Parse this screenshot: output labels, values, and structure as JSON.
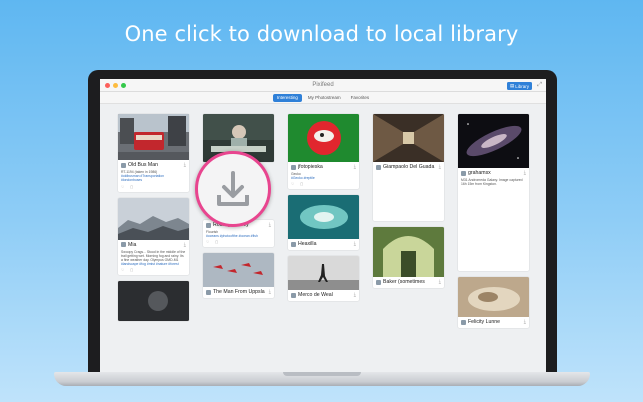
{
  "headline": "One click to download to local library",
  "app": {
    "title": "Pixifeed",
    "library_label": "Library"
  },
  "tabs": [
    {
      "label": "Interesting",
      "active": true
    },
    {
      "label": "My Photostream",
      "active": false
    },
    {
      "label": "Favorites",
      "active": false
    }
  ],
  "colors": {
    "accent": "#2f80d8",
    "badge_ring": "#e8458f"
  },
  "icons": {
    "download": "download-icon",
    "expand": "expand-icon"
  },
  "columns": [
    [
      {
        "user": "Old Bus Man",
        "caption": "RT-1194 (taken in 1986)",
        "tags": "#oldbusman #Transportation #londonbuses",
        "faves": "",
        "comments": ""
      },
      {
        "user": "Mia",
        "caption": "Swoopy Crags... Stood in the middle of the trail getting wet. Morning fog and rainy. Its a fine weather day. Olympus OMD-M1",
        "tags": "#landscape #fog #mist #nature #forest",
        "faves": "",
        "comments": ""
      },
      {
        "user": "",
        "caption": "",
        "tags": "",
        "faves": "",
        "comments": ""
      }
    ],
    [
      {
        "user": "",
        "caption": "",
        "tags": "",
        "faves": "",
        "comments": ""
      },
      {
        "user": "Rodney Harvey",
        "caption": "Flourish",
        "tags": "#oceans #photoofthe #ocean #fish",
        "faves": "",
        "comments": ""
      },
      {
        "user": "The Man From Uppsla",
        "caption": "",
        "tags": "",
        "faves": "",
        "comments": ""
      }
    ],
    [
      {
        "user": "jfotopieska",
        "caption": "Gecko",
        "tags": "#Gecko #reptile",
        "faves": "",
        "comments": ""
      },
      {
        "user": "Heaxilla",
        "caption": "",
        "tags": "",
        "faves": "",
        "comments": ""
      },
      {
        "user": "Merco de Weal",
        "caption": "",
        "tags": "",
        "faves": "",
        "comments": ""
      }
    ],
    [
      {
        "user": "Giampaolo Del Guada",
        "caption": "",
        "tags": "",
        "faves": "",
        "comments": ""
      },
      {
        "user": "Baker (sometimes",
        "caption": "",
        "tags": "",
        "faves": "",
        "comments": ""
      }
    ],
    [
      {
        "user": "grahamsx",
        "caption": "M31 Andromeda Galaxy. Image captured 16h 15m from Kingston.",
        "tags": "",
        "faves": "",
        "comments": ""
      },
      {
        "user": "Felicity Lunne",
        "caption": "",
        "tags": "",
        "faves": "",
        "comments": ""
      }
    ]
  ]
}
